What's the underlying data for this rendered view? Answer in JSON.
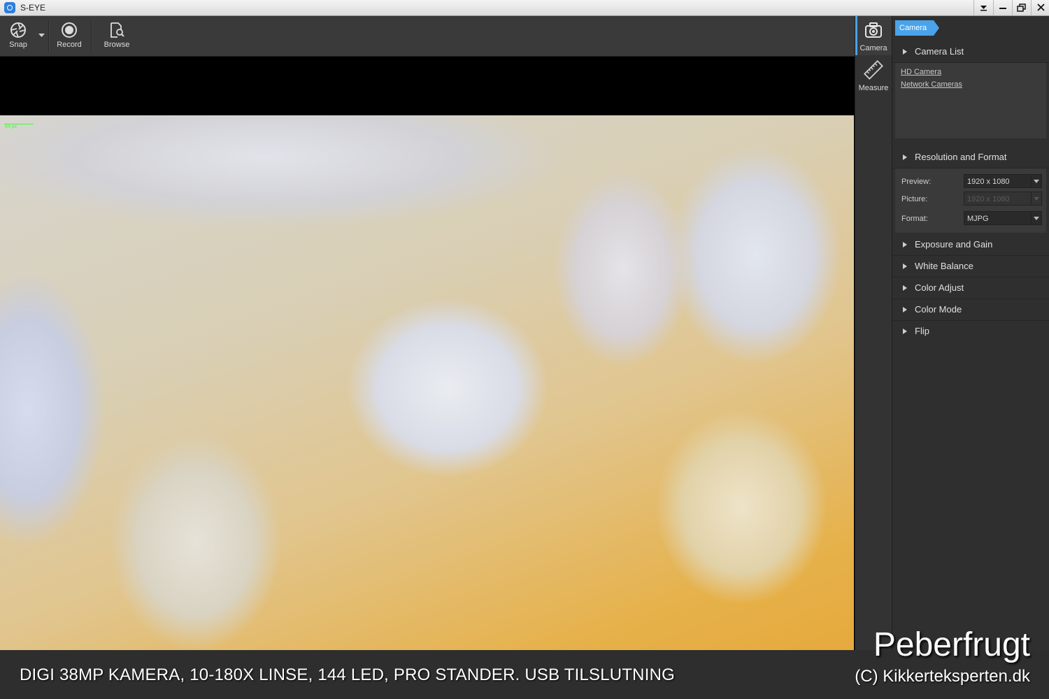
{
  "window": {
    "title": "S-EYE",
    "controls": [
      "dropdown",
      "minimize",
      "restore",
      "close"
    ]
  },
  "toolbar": {
    "snap_label": "Snap",
    "record_label": "Record",
    "browse_label": "Browse"
  },
  "viewer": {
    "scale_label": "84 px"
  },
  "sidetabs": {
    "camera_label": "Camera",
    "measure_label": "Measure"
  },
  "panel": {
    "breadcrumb": "Camera",
    "camera_list": {
      "title": "Camera List",
      "items": [
        "HD Camera",
        "Network Cameras"
      ]
    },
    "resolution": {
      "title": "Resolution and Format",
      "preview_label": "Preview:",
      "preview_value": "1920 x 1080",
      "picture_label": "Picture:",
      "picture_value": "1920 x 1080",
      "format_label": "Format:",
      "format_value": "MJPG"
    },
    "sections": [
      "Exposure and Gain",
      "White Balance",
      "Color Adjust",
      "Color Mode",
      "Flip"
    ]
  },
  "overlay": {
    "caption": "DIGI 38MP KAMERA, 10-180X LINSE, 144 LED, PRO STANDER. USB TILSLUTNING",
    "brand": "Peberfrugt",
    "copyright": "(C) Kikkerteksperten.dk"
  },
  "colors": {
    "accent": "#4aa3ea",
    "panel_bg": "#2f2f2f",
    "toolbar_bg": "#3a3a3a"
  }
}
